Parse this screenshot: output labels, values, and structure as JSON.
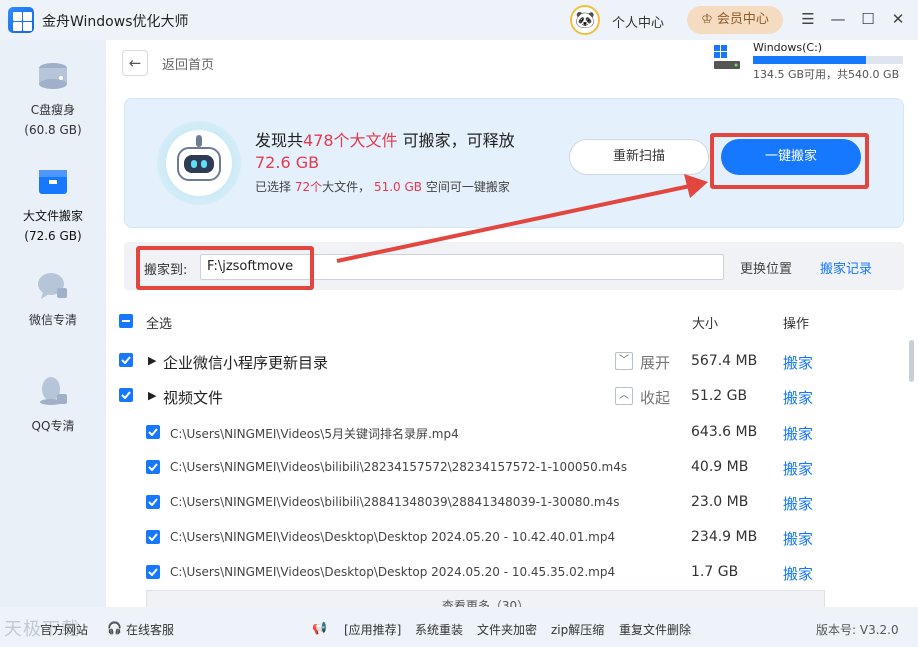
{
  "app": {
    "title": "金舟Windows优化大师",
    "personal_center": "个人中心",
    "vip_center": "会员中心"
  },
  "sidebar": {
    "items": [
      {
        "label": "C盘瘦身",
        "sub": "(60.8 GB)"
      },
      {
        "label": "大文件搬家",
        "sub": "(72.6 GB)"
      },
      {
        "label": "微信专清",
        "sub": ""
      },
      {
        "label": "QQ专清",
        "sub": ""
      }
    ]
  },
  "header": {
    "back_label": "返回首页",
    "drive_name": "Windows(C:)",
    "drive_space": "134.5 GB可用，共540.0 GB",
    "drive_used_fraction": 0.75
  },
  "banner": {
    "found_prefix": "发现共",
    "found_count": "478个大文件",
    "found_suffix": "可搬家，可释放",
    "releasable": "72.6 GB",
    "sel_prefix": "已选择",
    "sel_count": "72个",
    "sel_mid": "大文件，",
    "sel_size": "51.0 GB",
    "sel_suffix": "空间可一键搬家",
    "rescan": "重新扫描",
    "one_click_move": "一键搬家"
  },
  "destination": {
    "label": "搬家到:",
    "path": "F:\\jzsoftmove",
    "change": "更换位置",
    "record": "搬家记录"
  },
  "list": {
    "select_all": "全选",
    "col_size": "大小",
    "col_op": "操作",
    "groups": [
      {
        "name": "企业微信小程序更新目录",
        "toggle": "展开",
        "size": "567.4 MB",
        "op": "搬家"
      },
      {
        "name": "视频文件",
        "toggle": "收起",
        "size": "51.2 GB",
        "op": "搬家"
      }
    ],
    "files": [
      {
        "path": "C:\\Users\\NINGMEI\\Videos\\5月关键词排名录屏.mp4",
        "size": "643.6 MB",
        "op": "搬家"
      },
      {
        "path": "C:\\Users\\NINGMEI\\Videos\\bilibili\\28234157572\\28234157572-1-100050.m4s",
        "size": "40.9 MB",
        "op": "搬家"
      },
      {
        "path": "C:\\Users\\NINGMEI\\Videos\\bilibili\\28841348039\\28841348039-1-30080.m4s",
        "size": "23.0 MB",
        "op": "搬家"
      },
      {
        "path": "C:\\Users\\NINGMEI\\Videos\\Desktop\\Desktop 2024.05.20 - 10.42.40.01.mp4",
        "size": "234.9 MB",
        "op": "搬家"
      },
      {
        "path": "C:\\Users\\NINGMEI\\Videos\\Desktop\\Desktop 2024.05.20 - 10.45.35.02.mp4",
        "size": "1.7 GB",
        "op": "搬家"
      }
    ],
    "more": "查看更多（30）"
  },
  "footer": {
    "official": "官方网站",
    "support": "在线客服",
    "links": [
      "[应用推荐]",
      "系统重装",
      "文件夹加密",
      "zip解压缩",
      "重复文件删除"
    ],
    "version": "版本号: V3.2.0",
    "watermark": "天极下载"
  },
  "colors": {
    "accent": "#1677ff",
    "highlight": "#e8394d",
    "annotation": "#e3463e"
  }
}
